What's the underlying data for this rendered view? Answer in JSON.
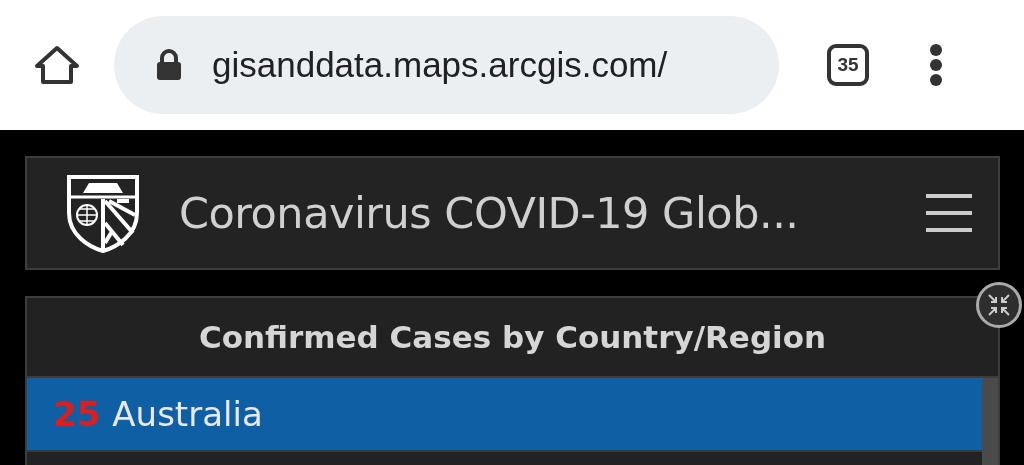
{
  "browser": {
    "url": "gisanddata.maps.arcgis.com/",
    "tab_count": "35"
  },
  "app": {
    "title": "Coronavirus COVID-19 Glob..."
  },
  "panel": {
    "title": "Confirmed Cases by Country/Region",
    "rows": [
      {
        "count": "25",
        "name": "Australia",
        "selected": true
      }
    ]
  }
}
